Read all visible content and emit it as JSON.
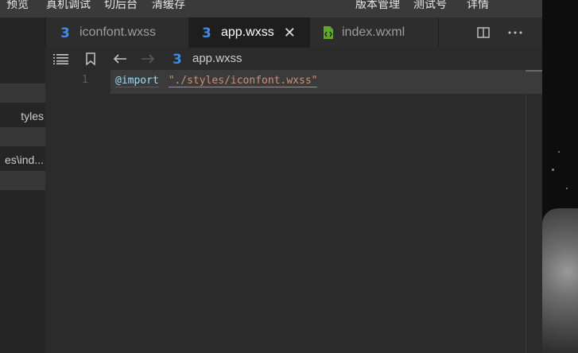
{
  "top_menu": [
    "预览",
    "真机调试",
    "切后台",
    "清缓存",
    "版本管理",
    "测试号",
    "详情"
  ],
  "explorer": {
    "rows": [
      {
        "label": "",
        "selected": true
      },
      {
        "label": "tyles",
        "selected": false
      },
      {
        "label": "",
        "selected": true
      },
      {
        "label": "es\\ind...",
        "selected": false
      },
      {
        "label": "",
        "selected": true
      }
    ]
  },
  "tabs": [
    {
      "label": "iconfont.wxss",
      "icon": "css-icon",
      "active": false
    },
    {
      "label": "app.wxss",
      "icon": "css-icon",
      "active": true,
      "close": "✕"
    },
    {
      "label": "index.wxml",
      "icon": "wxml-icon",
      "active": false
    }
  ],
  "breadcrumb": {
    "file": "app.wxss"
  },
  "editor": {
    "line_number": "1",
    "keyword": "@import",
    "quote_open": "\"",
    "path": "./styles/iconfont.wxss",
    "quote_close": "\""
  },
  "colors": {
    "css_icon": "#3f8be6",
    "wxml_icon": "#5ea92c",
    "string": "#ce9178",
    "keyword": "#9cdcfe"
  }
}
